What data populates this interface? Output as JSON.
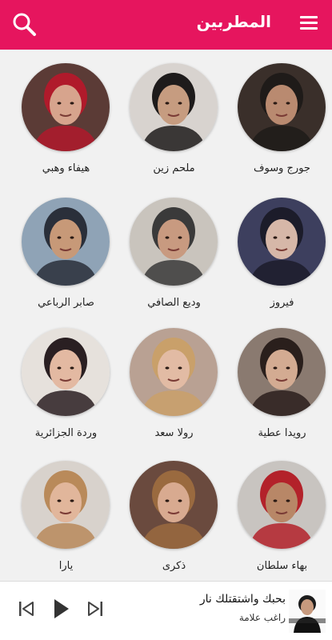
{
  "appbar": {
    "title": "المطربين",
    "search_icon": "search-icon",
    "menu_icon": "hamburger-menu-icon",
    "color": "#e6155e"
  },
  "artists": [
    {
      "name": "جورج وسوف",
      "tones": [
        "#3a2f2a",
        "#b98a70",
        "#1f1b19"
      ]
    },
    {
      "name": "ملحم زين",
      "tones": [
        "#d8d3cf",
        "#c69c80",
        "#1e1b1b"
      ]
    },
    {
      "name": "هيفاء وهبي",
      "tones": [
        "#5b3b36",
        "#d7a48d",
        "#b01a2b"
      ]
    },
    {
      "name": "فيروز",
      "tones": [
        "#3d3f5e",
        "#d6b7a8",
        "#1c1c2a"
      ]
    },
    {
      "name": "وديع الصافي",
      "tones": [
        "#c9c4bd",
        "#c89a80",
        "#3a3a3a"
      ]
    },
    {
      "name": "صابر الرباعي",
      "tones": [
        "#8fa3b6",
        "#c79978",
        "#2a2f3a"
      ]
    },
    {
      "name": "رويدا عطية",
      "tones": [
        "#8a7a70",
        "#d3ab92",
        "#2a1f1c"
      ]
    },
    {
      "name": "رولا سعد",
      "tones": [
        "#b9a193",
        "#e2bba4",
        "#c9a06a"
      ]
    },
    {
      "name": "وردة الجزائرية",
      "tones": [
        "#e6e1dc",
        "#e3b9a2",
        "#2a1f22"
      ]
    },
    {
      "name": "بهاء سلطان",
      "tones": [
        "#c8c4c0",
        "#b88767",
        "#b3222a"
      ]
    },
    {
      "name": "ذكرى",
      "tones": [
        "#6a4a3e",
        "#d8aa90",
        "#9a6a3f"
      ]
    },
    {
      "name": "يارا",
      "tones": [
        "#d8d2cc",
        "#e1b69b",
        "#b98a5a"
      ]
    }
  ],
  "player": {
    "song_title": "بحبك واشتقتلك نار",
    "singer": "راغب علامة",
    "prev_icon": "skip-previous-icon",
    "play_icon": "play-icon",
    "next_icon": "skip-next-icon",
    "thumbnail": "artist-thumbnail"
  }
}
